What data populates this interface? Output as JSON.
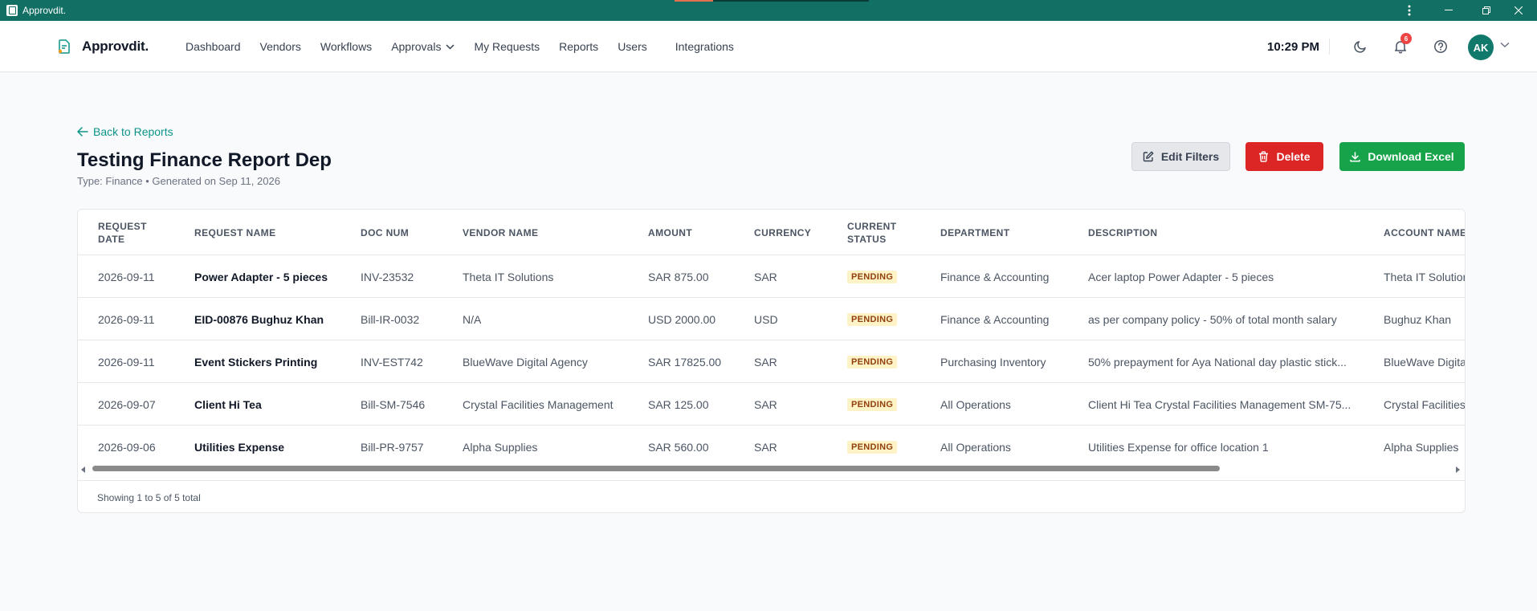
{
  "window": {
    "title": "Approvdit.",
    "accent_color": "#116f64"
  },
  "nav": {
    "brand": "Approvdit.",
    "items": [
      {
        "label": "Dashboard"
      },
      {
        "label": "Vendors"
      },
      {
        "label": "Workflows"
      },
      {
        "label": "Approvals",
        "has_dropdown": true
      },
      {
        "label": "My Requests"
      },
      {
        "label": "Reports"
      },
      {
        "label": "Users"
      },
      {
        "label": "Integrations"
      }
    ],
    "time": "10:29 PM",
    "notifications_count": "6",
    "avatar_initials": "AK"
  },
  "page": {
    "back_label": "Back to Reports",
    "title": "Testing Finance Report Dep",
    "subtitle": "Type: Finance • Generated on Sep 11, 2026",
    "actions": {
      "edit_filters": "Edit Filters",
      "delete": "Delete",
      "download": "Download Excel"
    }
  },
  "table": {
    "columns": [
      {
        "key": "date",
        "label": "REQUEST DATE"
      },
      {
        "key": "name",
        "label": "REQUEST NAME"
      },
      {
        "key": "doc",
        "label": "DOC NUM"
      },
      {
        "key": "vendor",
        "label": "VENDOR NAME"
      },
      {
        "key": "amount",
        "label": "AMOUNT"
      },
      {
        "key": "currency",
        "label": "CURRENCY"
      },
      {
        "key": "status",
        "label": "CURRENT STATUS"
      },
      {
        "key": "department",
        "label": "DEPARTMENT"
      },
      {
        "key": "description",
        "label": "DESCRIPTION"
      },
      {
        "key": "account",
        "label": "ACCOUNT NAME"
      }
    ],
    "rows": [
      {
        "date": "2026-09-11",
        "name": "Power Adapter - 5 pieces",
        "doc": "INV-23532",
        "vendor": "Theta IT Solutions",
        "amount": "SAR 875.00",
        "currency": "SAR",
        "status": "PENDING",
        "department": "Finance & Accounting",
        "description": "Acer laptop Power Adapter - 5 pieces",
        "account": "Theta IT Solutions"
      },
      {
        "date": "2026-09-11",
        "name": "EID-00876 Bughuz Khan",
        "doc": "Bill-IR-0032",
        "vendor": "N/A",
        "amount": "USD 2000.00",
        "currency": "USD",
        "status": "PENDING",
        "department": "Finance & Accounting",
        "description": "as per company policy - 50% of total month salary",
        "account": "Bughuz Khan"
      },
      {
        "date": "2026-09-11",
        "name": "Event Stickers Printing",
        "doc": "INV-EST742",
        "vendor": "BlueWave Digital Agency",
        "amount": "SAR 17825.00",
        "currency": "SAR",
        "status": "PENDING",
        "department": "Purchasing Inventory",
        "description": "50% prepayment for Aya National day plastic stick...",
        "account": "BlueWave Digital Agency"
      },
      {
        "date": "2026-09-07",
        "name": "Client Hi Tea",
        "doc": "Bill-SM-7546",
        "vendor": "Crystal Facilities Management",
        "amount": "SAR 125.00",
        "currency": "SAR",
        "status": "PENDING",
        "department": "All Operations",
        "description": "Client Hi Tea Crystal Facilities Management SM-75...",
        "account": "Crystal Facilities Management"
      },
      {
        "date": "2026-09-06",
        "name": "Utilities Expense",
        "doc": "Bill-PR-9757",
        "vendor": "Alpha Supplies",
        "amount": "SAR 560.00",
        "currency": "SAR",
        "status": "PENDING",
        "department": "All Operations",
        "description": "Utilities Expense for office location 1",
        "account": "Alpha Supplies"
      }
    ],
    "footer": "Showing 1 to 5 of 5 total"
  }
}
